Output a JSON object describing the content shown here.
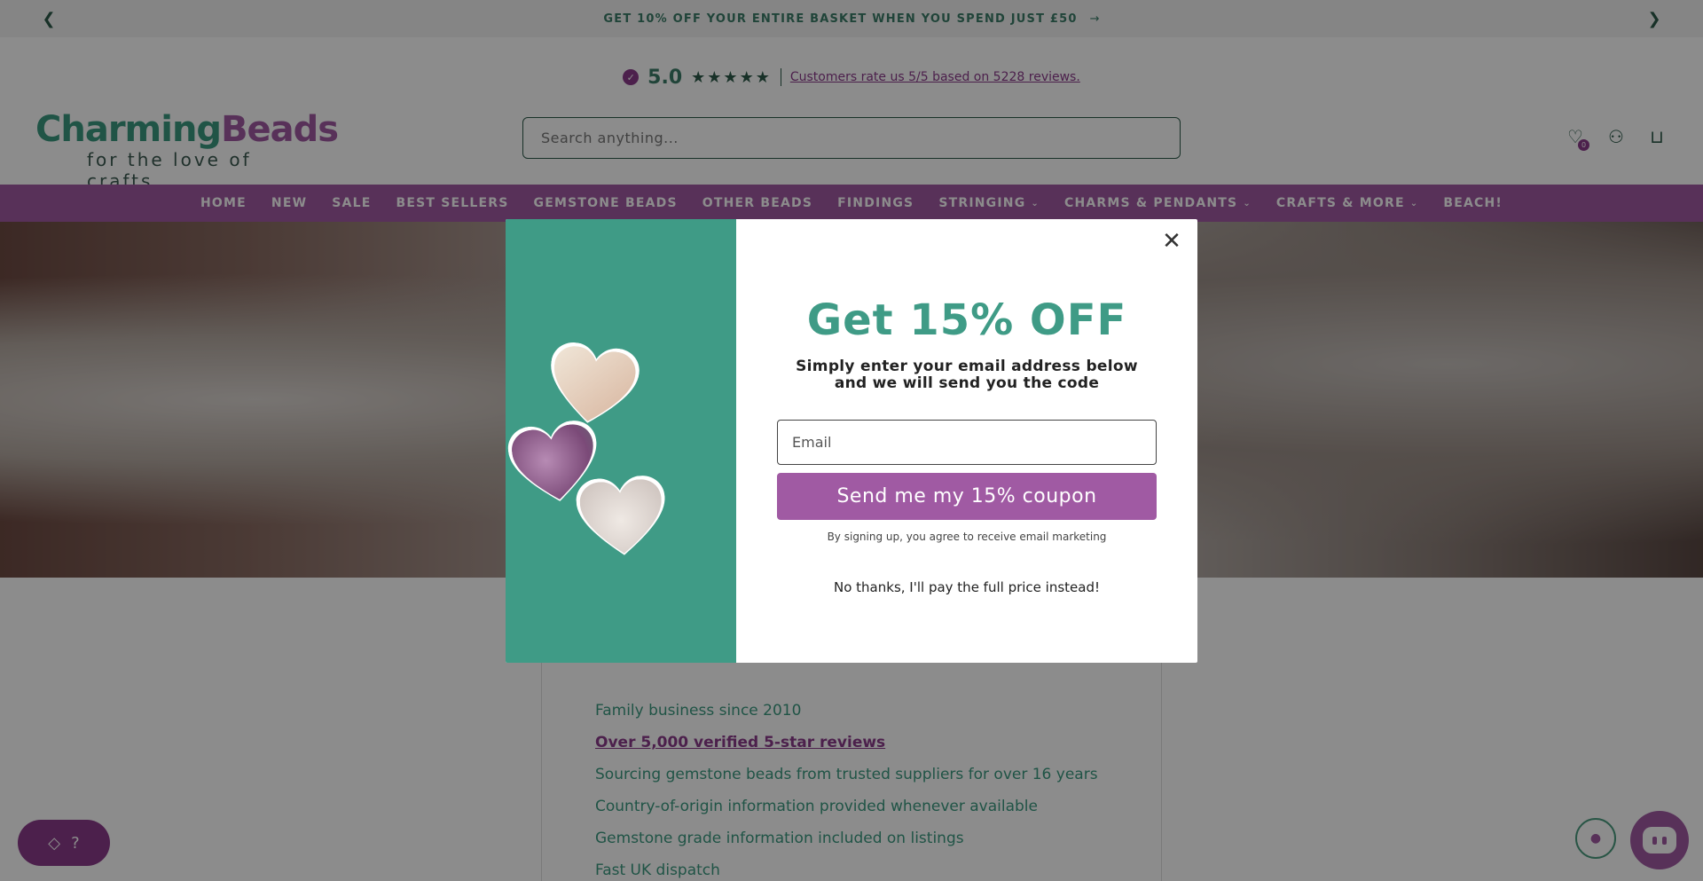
{
  "announcement": {
    "message": "GET 10% OFF YOUR ENTIRE BASKET WHEN YOU SPEND JUST £50",
    "msg_arrow": "→",
    "prev_glyph": "❮",
    "next_glyph": "❯"
  },
  "rating": {
    "check_glyph": "✓",
    "score": "5.0",
    "stars": "★★★★★",
    "reviews_text": "Customers rate us 5/5 based on 5228 reviews."
  },
  "logo": {
    "word1": "Charming",
    "word2": "Beads",
    "tagline": "for the love of crafts"
  },
  "search": {
    "placeholder": "Search anything..."
  },
  "header_icons": {
    "wishlist_glyph": "♡",
    "wishlist_count": "0",
    "account_glyph": "⚇",
    "cart_glyph": "⊔"
  },
  "nav": {
    "items": [
      {
        "label": "HOME"
      },
      {
        "label": "NEW"
      },
      {
        "label": "SALE"
      },
      {
        "label": "BEST SELLERS"
      },
      {
        "label": "GEMSTONE BEADS"
      },
      {
        "label": "OTHER BEADS"
      },
      {
        "label": "FINDINGS"
      },
      {
        "label": "STRINGING",
        "chevron": "⌄"
      },
      {
        "label": "CHARMS & PENDANTS",
        "chevron": "⌄"
      },
      {
        "label": "CRAFTS & MORE",
        "chevron": "⌄"
      },
      {
        "label": "BEACH!"
      }
    ]
  },
  "features": [
    "Family business since 2010",
    "Over 5,000 verified 5-star reviews",
    "Sourcing gemstone beads from trusted suppliers for over 16 years",
    "Country-of-origin information provided whenever available",
    "Gemstone grade information included on listings",
    "Fast UK dispatch"
  ],
  "rewards": {
    "glyph": "◇",
    "text": "?"
  },
  "chat_mini": {
    "glyph": "●"
  },
  "modal": {
    "close_glyph": "✕",
    "title": "Get 15% OFF",
    "subtitle_line1": "Simply enter your email address below",
    "subtitle_line2": "and we will send you the code",
    "email_placeholder": "Email",
    "button_label": "Send me my 15% coupon",
    "legal": "By signing up, you agree to receive email marketing",
    "decline": "No thanks, I'll pay the full price instead!"
  },
  "colors": {
    "brand_green": "#3f9b86",
    "brand_purple": "#a05aa3",
    "dark_purple": "#8b3b8b"
  }
}
